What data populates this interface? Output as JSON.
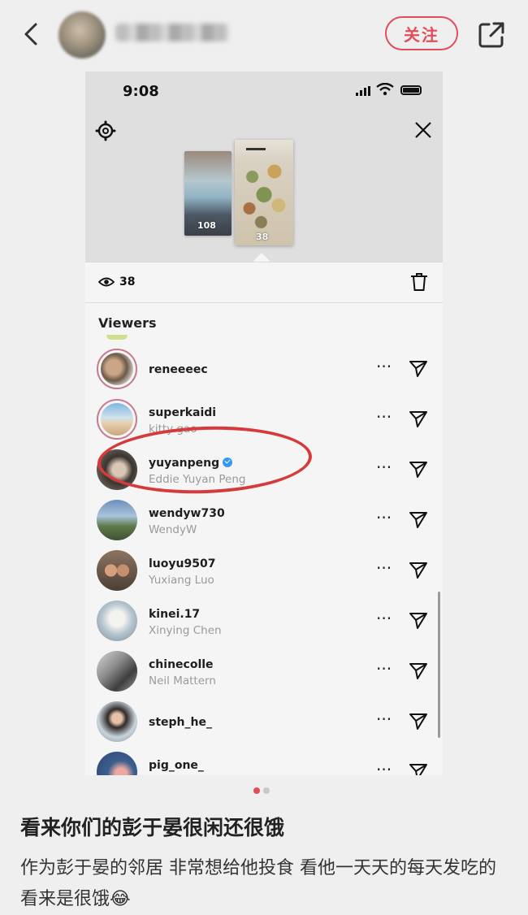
{
  "header": {
    "follow_label": "关注"
  },
  "screenshot": {
    "status_time": "9:08",
    "thumb_counts": [
      "108",
      "38"
    ],
    "view_count": "38",
    "viewers_heading": "Viewers",
    "viewers": [
      {
        "username": "reneeeec",
        "fullname": ""
      },
      {
        "username": "superkaidi",
        "fullname": "kitty gao"
      },
      {
        "username": "yuyanpeng",
        "fullname": "Eddie Yuyan Peng",
        "verified": true
      },
      {
        "username": "wendyw730",
        "fullname": "WendyW"
      },
      {
        "username": "luoyu9507",
        "fullname": "Yuxiang Luo"
      },
      {
        "username": "kinei.17",
        "fullname": "Xinying Chen"
      },
      {
        "username": "chinecolle",
        "fullname": "Neil Mattern"
      },
      {
        "username": "steph_he_",
        "fullname": ""
      },
      {
        "username": "pig_one_",
        "fullname": ""
      }
    ],
    "more_glyph": "···",
    "annotation_color": "#d63a3a"
  },
  "carousel": {
    "active_color": "#e24d5a",
    "inactive_color": "#c8c8c8"
  },
  "post": {
    "title": "看来你们的彭于晏很闲还很饿",
    "body": "作为彭于晏的邻居 非常想给他投食 看他一天天的每天发吃的 看来是很饿😂"
  }
}
